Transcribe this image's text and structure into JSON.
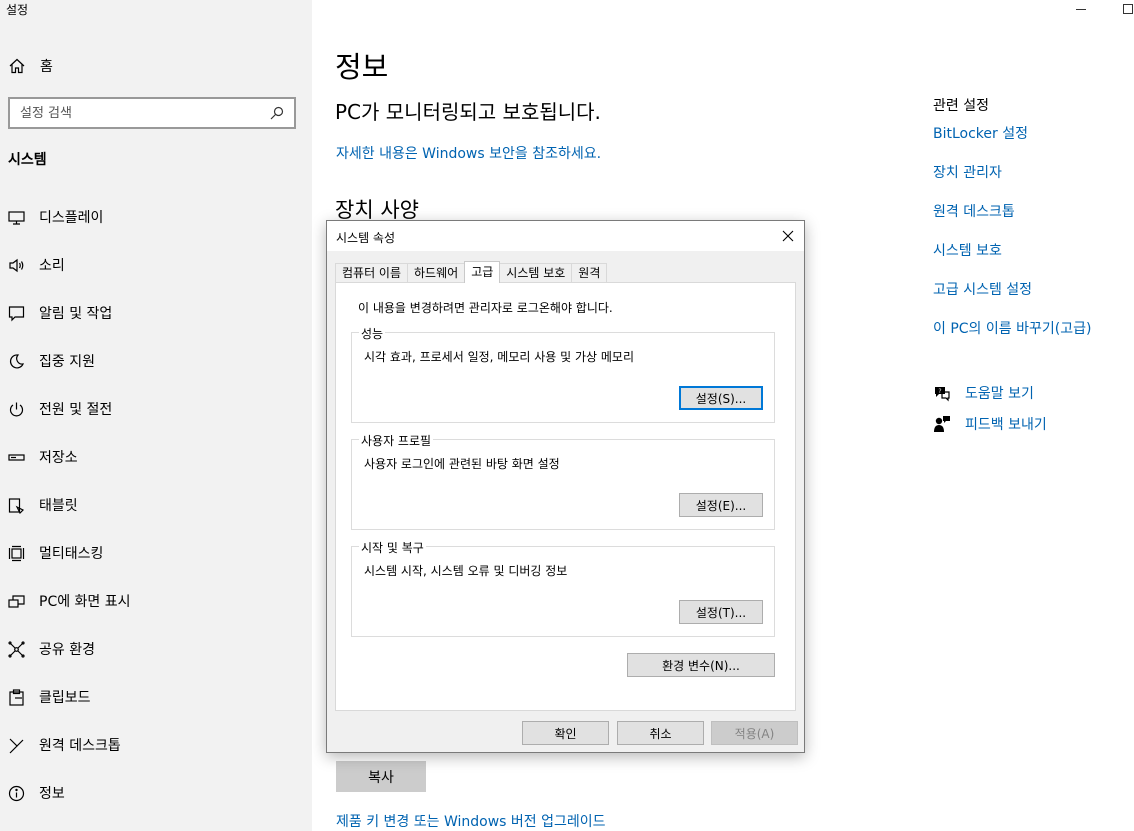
{
  "app": {
    "title": "설정"
  },
  "sidebar": {
    "home_label": "홈",
    "search_placeholder": "설정 검색",
    "section_title": "시스템",
    "items": [
      {
        "label": "디스플레이",
        "icon": "display-icon"
      },
      {
        "label": "소리",
        "icon": "speaker-icon"
      },
      {
        "label": "알림 및 작업",
        "icon": "notification-icon"
      },
      {
        "label": "집중 지원",
        "icon": "moon-icon"
      },
      {
        "label": "전원 및 절전",
        "icon": "power-icon"
      },
      {
        "label": "저장소",
        "icon": "storage-icon"
      },
      {
        "label": "태블릿",
        "icon": "tablet-icon"
      },
      {
        "label": "멀티태스킹",
        "icon": "multitasking-icon"
      },
      {
        "label": "PC에 화면 표시",
        "icon": "projecting-icon"
      },
      {
        "label": "공유 환경",
        "icon": "shared-experiences-icon"
      },
      {
        "label": "클립보드",
        "icon": "clipboard-icon"
      },
      {
        "label": "원격 데스크톱",
        "icon": "remote-desktop-icon"
      },
      {
        "label": "정보",
        "icon": "info-icon"
      }
    ]
  },
  "main": {
    "title": "정보",
    "status": "PC가 모니터링되고 보호됩니다.",
    "details_link": "자세한 내용은 Windows 보안을 참조하세요.",
    "spec_heading": "장치 사양",
    "copy_button": "복사",
    "upgrade_link": "제품 키 변경 또는 Windows 버전 업그레이드"
  },
  "related": {
    "title": "관련 설정",
    "links": [
      "BitLocker 설정",
      "장치 관리자",
      "원격 데스크톱",
      "시스템 보호",
      "고급 시스템 설정",
      "이 PC의 이름 바꾸기(고급)"
    ],
    "help_label": "도움말 보기",
    "feedback_label": "피드백 보내기"
  },
  "dialog": {
    "title": "시스템 속성",
    "tabs": [
      "컴퓨터 이름",
      "하드웨어",
      "고급",
      "시스템 보호",
      "원격"
    ],
    "active_tab": "고급",
    "admin_note": "이 내용을 변경하려면 관리자로 로그온해야 합니다.",
    "performance": {
      "label": "성능",
      "desc": "시각 효과, 프로세서 일정, 메모리 사용 및 가상 메모리",
      "button": "설정(S)..."
    },
    "user_profiles": {
      "label": "사용자 프로필",
      "desc": "사용자 로그인에 관련된 바탕 화면 설정",
      "button": "설정(E)..."
    },
    "startup_recovery": {
      "label": "시작 및 복구",
      "desc": "시스템 시작, 시스템 오류 및 디버깅 정보",
      "button": "설정(T)..."
    },
    "env_button": "환경 변수(N)...",
    "ok": "확인",
    "cancel": "취소",
    "apply": "적용(A)"
  },
  "colors": {
    "link": "#0063b1",
    "sidebar_bg": "#f2f2f2",
    "default_button_border": "#0078d7"
  }
}
